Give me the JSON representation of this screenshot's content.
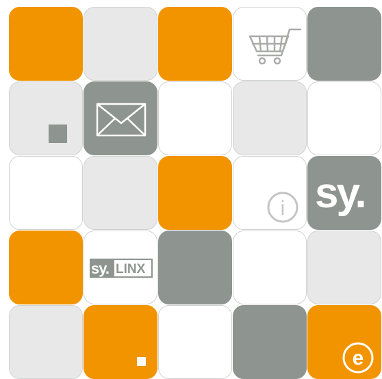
{
  "tiles": [
    {
      "id": "r1c1",
      "color": "#f29400"
    },
    {
      "id": "r1c2",
      "color": "#e8e8e8"
    },
    {
      "id": "r1c3",
      "color": "#f29400"
    },
    {
      "id": "r1c4",
      "color": "#ffffff",
      "icon": "shopping-cart-icon"
    },
    {
      "id": "r1c5",
      "color": "#8e9490"
    },
    {
      "id": "r2c1",
      "color": "#e8e8e8",
      "icon": "small-square-icon"
    },
    {
      "id": "r2c2",
      "color": "#8e9490",
      "icon": "envelope-icon"
    },
    {
      "id": "r2c3",
      "color": "#ffffff"
    },
    {
      "id": "r2c4",
      "color": "#e8e8e8"
    },
    {
      "id": "r2c5",
      "color": "#ffffff"
    },
    {
      "id": "r3c1",
      "color": "#ffffff"
    },
    {
      "id": "r3c2",
      "color": "#e8e8e8"
    },
    {
      "id": "r3c3",
      "color": "#f29400"
    },
    {
      "id": "r3c4",
      "color": "#ffffff",
      "icon": "info-icon"
    },
    {
      "id": "r3c5",
      "color": "#8e9490",
      "icon": "sy-logo-icon"
    },
    {
      "id": "r4c1",
      "color": "#f29400"
    },
    {
      "id": "r4c2",
      "color": "#ffffff",
      "icon": "sylinx-logo-icon"
    },
    {
      "id": "r4c3",
      "color": "#8e9490"
    },
    {
      "id": "r4c4",
      "color": "#ffffff"
    },
    {
      "id": "r4c5",
      "color": "#e8e8e8"
    },
    {
      "id": "r5c1",
      "color": "#e8e8e8"
    },
    {
      "id": "r5c2",
      "color": "#f29400",
      "icon": "small-square-icon"
    },
    {
      "id": "r5c3",
      "color": "#ffffff"
    },
    {
      "id": "r5c4",
      "color": "#8e9490"
    },
    {
      "id": "r5c5",
      "color": "#f29400",
      "icon": "e-circle-icon"
    }
  ],
  "logos": {
    "sy": "sy.",
    "sylinx_sy": "sy.",
    "sylinx_linx": "LINX",
    "e": "e",
    "info": "i"
  },
  "colors": {
    "orange": "#f29400",
    "gray": "#8e9490",
    "light": "#e8e8e8",
    "white": "#ffffff"
  }
}
